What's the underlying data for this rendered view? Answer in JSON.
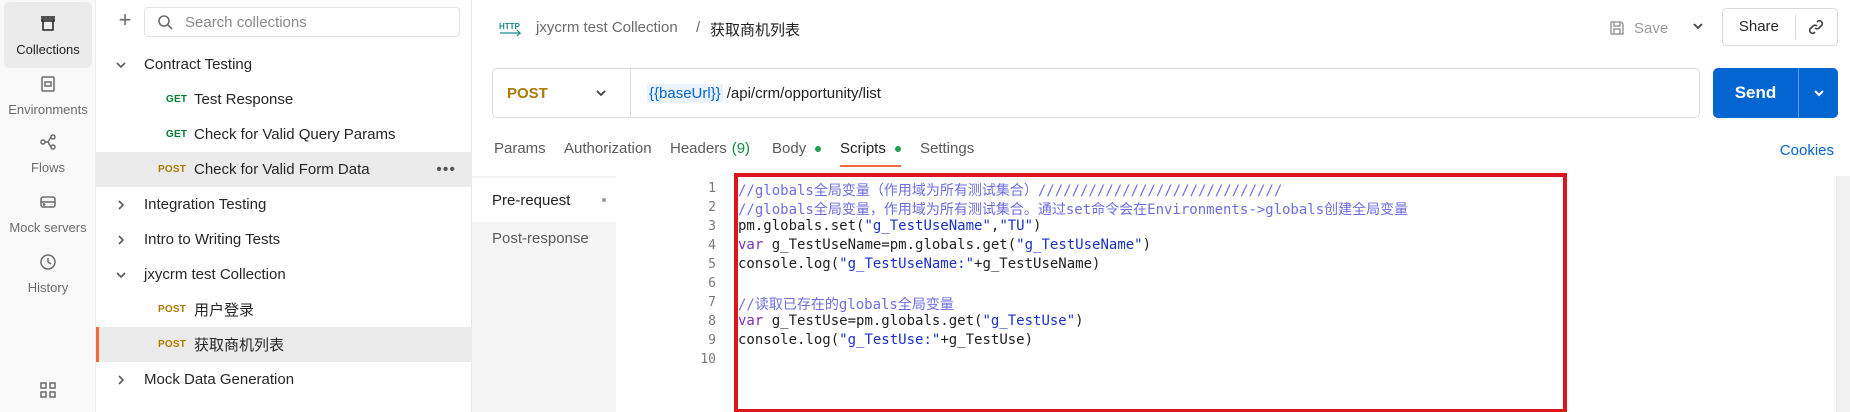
{
  "rail": {
    "items": [
      {
        "label": "Collections",
        "icon": "collections-icon",
        "active": true
      },
      {
        "label": "Environments",
        "icon": "environments-icon",
        "active": false
      },
      {
        "label": "Flows",
        "icon": "flows-icon",
        "active": false
      },
      {
        "label": "Mock servers",
        "icon": "mock-servers-icon",
        "active": false
      },
      {
        "label": "History",
        "icon": "history-icon",
        "active": false
      }
    ]
  },
  "sidebar": {
    "search_placeholder": "Search collections",
    "tree": [
      {
        "type": "folder",
        "label": "Contract Testing",
        "expanded": true
      },
      {
        "type": "request",
        "method": "GET",
        "label": "Test Response"
      },
      {
        "type": "request",
        "method": "GET",
        "label": "Check for Valid Query Params"
      },
      {
        "type": "request",
        "method": "POST",
        "label": "Check for Valid Form Data",
        "selected": true
      },
      {
        "type": "folder",
        "label": "Integration Testing",
        "expanded": false
      },
      {
        "type": "folder",
        "label": "Intro to Writing Tests",
        "expanded": false
      },
      {
        "type": "folder",
        "label": "jxycrm test Collection",
        "expanded": true
      },
      {
        "type": "request",
        "method": "POST",
        "label": "用户登录"
      },
      {
        "type": "request",
        "method": "POST",
        "label": "获取商机列表",
        "active": true
      },
      {
        "type": "folder",
        "label": "Mock Data Generation",
        "expanded": false
      }
    ]
  },
  "header": {
    "http_badge": "HTTP",
    "breadcrumb_parent": "jxycrm test Collection",
    "breadcrumb_sep": "/",
    "breadcrumb_current": "获取商机列表",
    "save_label": "Save",
    "share_label": "Share"
  },
  "request": {
    "method": "POST",
    "url_variable": "{{baseUrl}}",
    "url_path": "/api/crm/opportunity/list",
    "send_label": "Send"
  },
  "tabs": [
    {
      "label": "Params"
    },
    {
      "label": "Authorization"
    },
    {
      "label": "Headers",
      "count": "(9)"
    },
    {
      "label": "Body",
      "dot": true
    },
    {
      "label": "Scripts",
      "dot": true,
      "active": true
    },
    {
      "label": "Settings"
    }
  ],
  "cookies_label": "Cookies",
  "scripts": {
    "subtabs": [
      "Pre-request",
      "Post-response"
    ],
    "lines": [
      "1",
      "2",
      "3",
      "4",
      "5",
      "6",
      "7",
      "8",
      "9",
      "10"
    ],
    "code": {
      "l1": "//globals全局变量（作用域为所有测试集合）/////////////////////////////",
      "l2": "//globals全局变量，作用域为所有测试集合。通过set命令会在Environments->globals创建全局变量",
      "l3_a": "pm.globals.set(",
      "l3_s1": "\"g_TestUseName\"",
      "l3_c": ",",
      "l3_s2": "\"TU\"",
      "l3_e": ")",
      "l4_kw": "var",
      "l4_a": " g_TestUseName=pm.globals.get(",
      "l4_s": "\"g_TestUseName\"",
      "l4_e": ")",
      "l5_a": "console.log(",
      "l5_s": "\"g_TestUseName:\"",
      "l5_e": "+g_TestUseName)",
      "l7": "//读取已存在的globals全局变量",
      "l8_kw": "var",
      "l8_a": " g_TestUse=pm.globals.get(",
      "l8_s": "\"g_TestUse\"",
      "l8_e": ")",
      "l9_a": "console.log(",
      "l9_s": "\"g_TestUse:\"",
      "l9_e": "+g_TestUse)"
    }
  },
  "colors": {
    "accent": "#f26b3a",
    "send": "#0265d2",
    "get": "#007f31",
    "post": "#ad7a03",
    "highlight": "#e0141e"
  }
}
